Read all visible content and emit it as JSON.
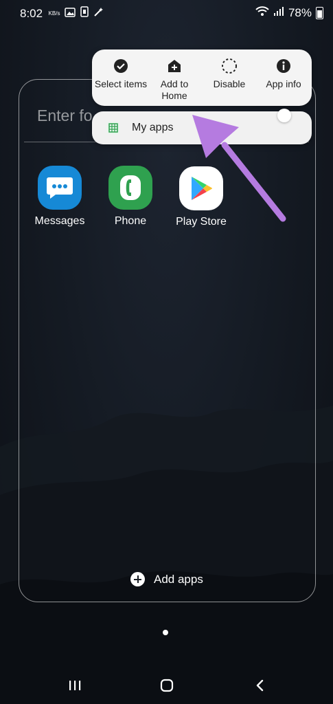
{
  "status_bar": {
    "time": "8:02",
    "kbs_label": "KB/s",
    "battery": "78%"
  },
  "folder": {
    "name_placeholder": "Enter fo"
  },
  "apps": [
    {
      "label": "Messages",
      "icon": "messages-icon",
      "color": "#1689d6"
    },
    {
      "label": "Phone",
      "icon": "phone-icon",
      "color": "#2fa14f"
    },
    {
      "label": "Play Store",
      "icon": "play-store-icon",
      "color": "#ffffff"
    }
  ],
  "popup_menu": {
    "items": [
      {
        "label": "Select items",
        "icon": "check-circle-icon"
      },
      {
        "label": "Add to Home",
        "icon": "home-add-icon"
      },
      {
        "label": "Disable",
        "icon": "dashed-circle-icon"
      },
      {
        "label": "App info",
        "icon": "info-icon"
      }
    ],
    "shortcut": {
      "label": "My apps",
      "icon": "grid-shortcut-icon"
    }
  },
  "add_apps_label": "Add apps",
  "accent_arrow_color": "#b57be0"
}
